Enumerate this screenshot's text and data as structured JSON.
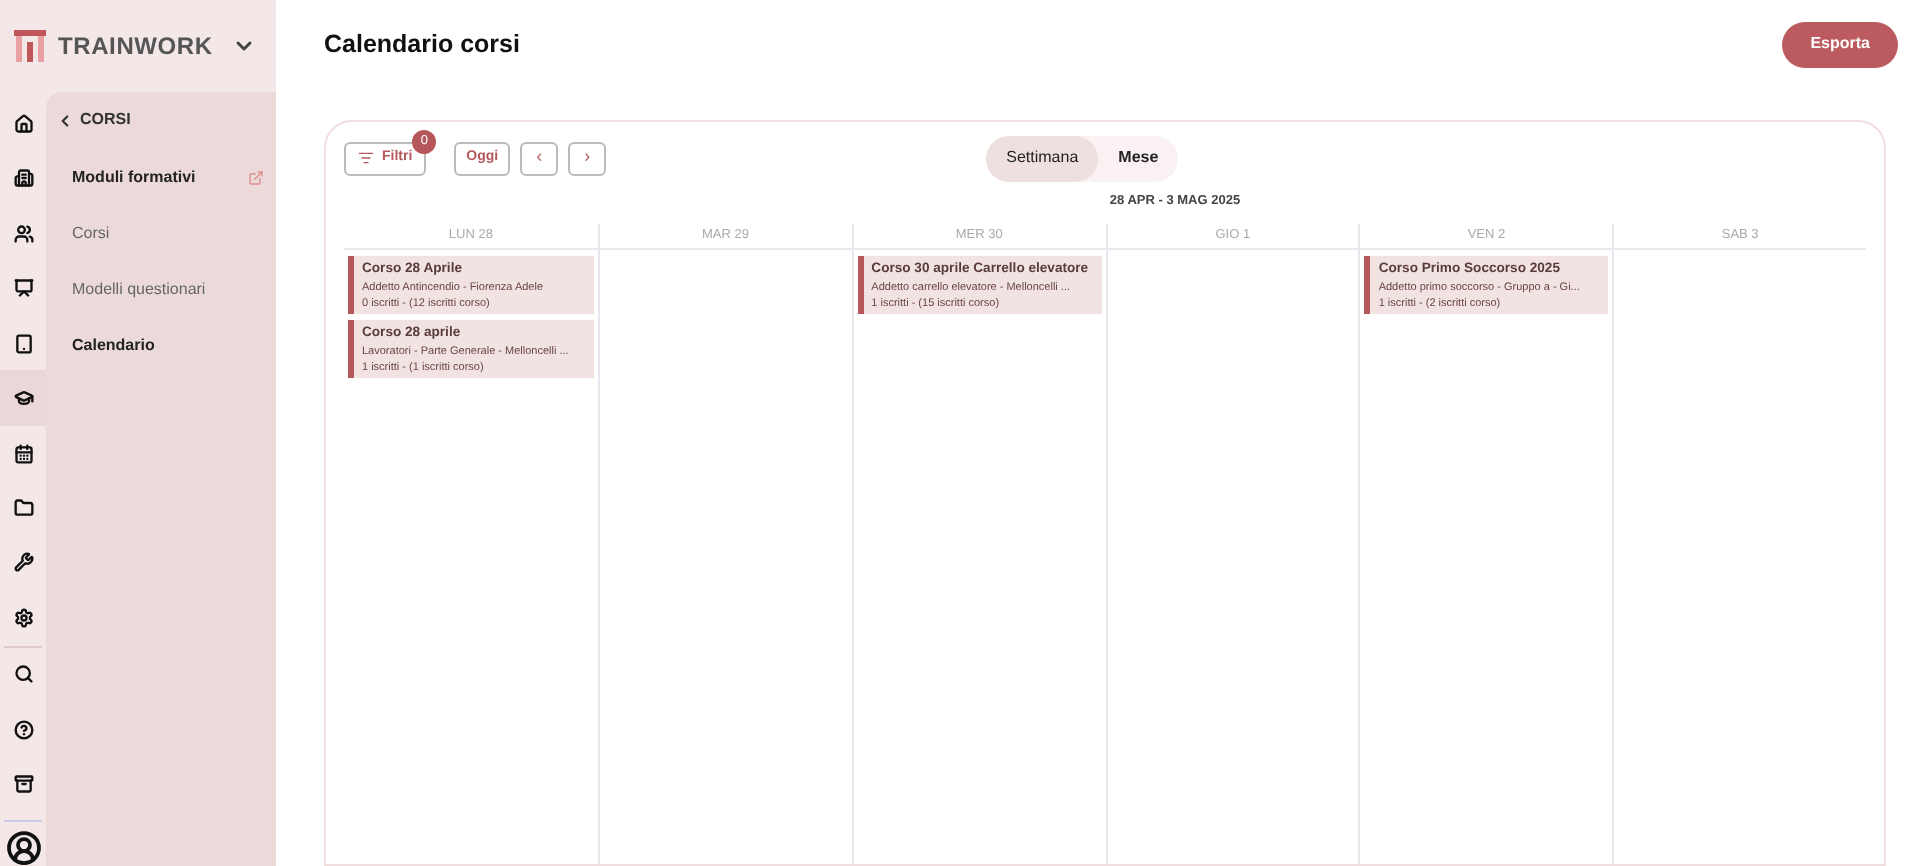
{
  "brand": {
    "name": "TRAINWORK"
  },
  "rail": [
    {
      "selected": false
    },
    {
      "selected": false
    },
    {
      "selected": false
    },
    {
      "selected": false
    },
    {
      "selected": false
    },
    {
      "selected": true
    },
    {
      "selected": false
    },
    {
      "selected": false
    },
    {
      "selected": false
    },
    {
      "selected": false
    },
    {
      "selected": false
    },
    {
      "selected": false
    },
    {
      "selected": false
    }
  ],
  "submenu": {
    "back_label": "CORSI",
    "items": [
      {
        "label": "Moduli formativi",
        "bold": true,
        "external": true
      },
      {
        "label": "Corsi",
        "bold": false,
        "external": false
      },
      {
        "label": "Modelli questionari",
        "bold": false,
        "external": false
      },
      {
        "label": "Calendario",
        "bold": true,
        "external": false
      }
    ]
  },
  "header": {
    "title": "Calendario corsi",
    "export_button": "Esporta"
  },
  "toolbar": {
    "filters": "Filtri",
    "filter_count": "0",
    "today": "Oggi",
    "prev": "‹",
    "next": "›",
    "views": [
      {
        "label": "Settimana",
        "selected": true
      },
      {
        "label": "Mese",
        "selected": false
      }
    ]
  },
  "range": "28 APR - 3 MAG 2025",
  "days": [
    {
      "label": "LUN 28",
      "events": [
        {
          "title": "Corso 28 Aprile",
          "detail": "Addetto Antincendio - Fiorenza Adele",
          "count": "0 iscritti - (12 iscritti corso)"
        },
        {
          "title": "Corso 28 aprile",
          "detail": "Lavoratori - Parte Generale - Melloncelli ...",
          "count": "1 iscritti - (1 iscritti corso)"
        }
      ]
    },
    {
      "label": "MAR 29"
    },
    {
      "label": "MER 30",
      "events": [
        {
          "title": "Corso 30 aprile Carrello elevatore",
          "detail": "Addetto carrello elevatore - Melloncelli ...",
          "count": "1 iscritti - (15 iscritti corso)"
        }
      ]
    },
    {
      "label": "GIO 1"
    },
    {
      "label": "VEN 2",
      "events": [
        {
          "title": "Corso Primo Soccorso 2025",
          "detail": "Addetto primo soccorso - Gruppo a - Gi...",
          "count": "1 iscritti - (2 iscritti corso)"
        }
      ]
    },
    {
      "label": "SAB 3"
    }
  ]
}
